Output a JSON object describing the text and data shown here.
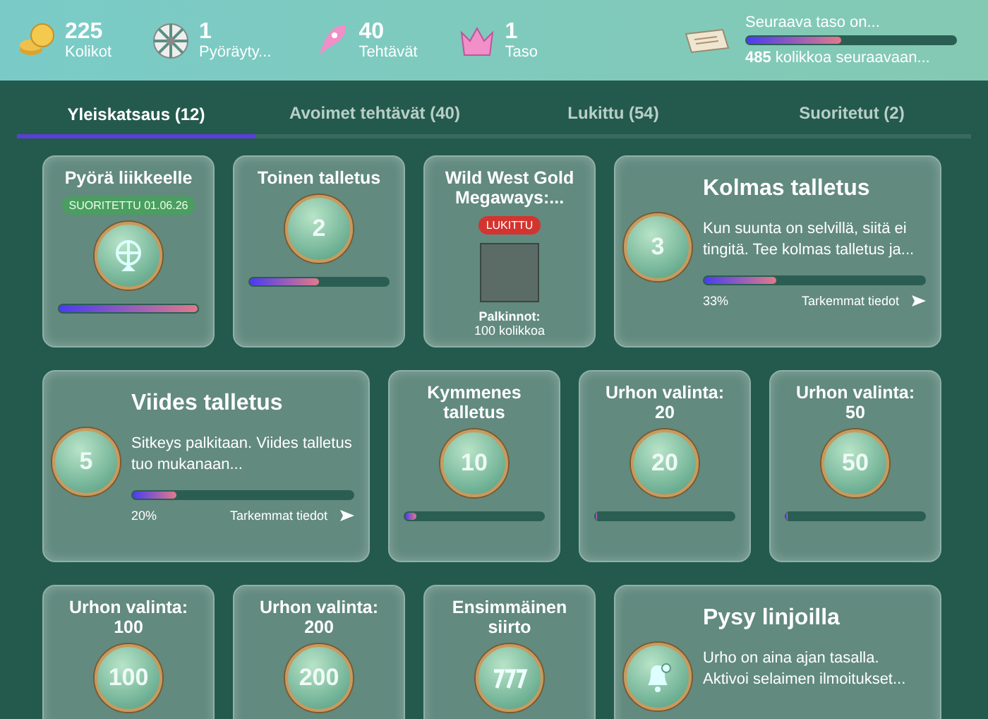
{
  "header": {
    "stats": [
      {
        "kind": "coins",
        "value": "225",
        "label": "Kolikot"
      },
      {
        "kind": "wheel",
        "value": "1",
        "label": "Pyöräyty..."
      },
      {
        "kind": "rocket",
        "value": "40",
        "label": "Tehtävät"
      },
      {
        "kind": "crown",
        "value": "1",
        "label": "Taso"
      }
    ],
    "next_level": {
      "title": "Seuraava taso on...",
      "level": 0.45,
      "note": "**485** kolikkoa seuraavaan..."
    }
  },
  "tabs": [
    {
      "label": "Yleiskatsaus (12)",
      "selected": true
    },
    {
      "label": "Avoimet tehtävät (40)",
      "selected": false
    },
    {
      "label": "Lukittu (54)",
      "selected": false
    },
    {
      "label": "Suoritetut (2)",
      "selected": false
    }
  ],
  "rows": [
    {
      "cards": [
        {
          "kind": "small",
          "title": "Pyörä liikkeelle",
          "badge": {
            "kind": "completed",
            "text": "SUORITETTU 01.06.26"
          },
          "medal": {
            "kind": "wheel"
          },
          "level": 1.0
        },
        {
          "kind": "small",
          "title": "Toinen talletus",
          "medal": {
            "kind": "text",
            "text": "2"
          },
          "level": 0.5
        },
        {
          "kind": "small",
          "title": "Wild West Gold Megaways:...",
          "badge": {
            "kind": "locked",
            "text": "LUKITTU"
          },
          "medal": {
            "kind": "game"
          },
          "rewards": {
            "label": "Palkinnot:",
            "value": "100 kolikkoa"
          }
        },
        {
          "kind": "wide",
          "title": "Kolmas talletus",
          "medal": {
            "kind": "text",
            "text": "3"
          },
          "description": "Kun suunta on selvillä, siitä ei tingitä. Tee kolmas talletus ja...",
          "level": 0.33,
          "percent": "33%",
          "link": "Tarkemmat tiedot"
        }
      ]
    },
    {
      "cards": [
        {
          "kind": "wide",
          "title": "Viides talletus",
          "medal": {
            "kind": "text",
            "text": "5"
          },
          "description": "Sitkeys palkitaan. Viides talletus tuo mukanaan...",
          "level": 0.2,
          "percent": "20%",
          "link": "Tarkemmat tiedot"
        },
        {
          "kind": "small",
          "title": "Kymmenes talletus",
          "medal": {
            "kind": "text",
            "text": "10"
          },
          "level": 0.08
        },
        {
          "kind": "small",
          "title": "Urhon valinta: 20",
          "medal": {
            "kind": "text",
            "text": "20"
          },
          "level": 0.01
        },
        {
          "kind": "small",
          "title": "Urhon valinta: 50",
          "medal": {
            "kind": "text",
            "text": "50"
          },
          "level": 0.01
        }
      ]
    },
    {
      "cards": [
        {
          "kind": "small",
          "title": "Urhon valinta: 100",
          "medal": {
            "kind": "text",
            "text": "100"
          }
        },
        {
          "kind": "small",
          "title": "Urhon valinta: 200",
          "medal": {
            "kind": "text",
            "text": "200"
          }
        },
        {
          "kind": "small",
          "title": "Ensimmäinen siirto",
          "medal": {
            "kind": "slots"
          }
        },
        {
          "kind": "wide",
          "title": "Pysy linjoilla",
          "medal": {
            "kind": "bell"
          },
          "description": "Urho on aina ajan tasalla. Aktivoi selaimen ilmoitukset..."
        }
      ]
    }
  ]
}
